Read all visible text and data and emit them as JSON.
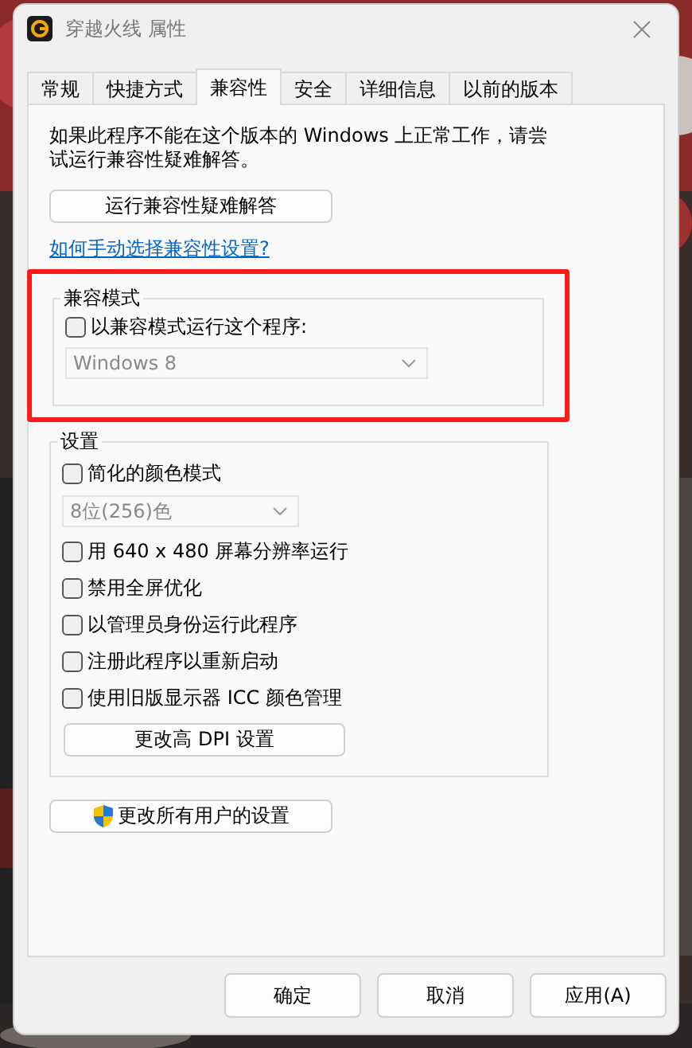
{
  "window": {
    "title": "穿越火线 属性"
  },
  "tabs": [
    {
      "label": "常规",
      "selected": false
    },
    {
      "label": "快捷方式",
      "selected": false
    },
    {
      "label": "兼容性",
      "selected": true
    },
    {
      "label": "安全",
      "selected": false
    },
    {
      "label": "详细信息",
      "selected": false
    },
    {
      "label": "以前的版本",
      "selected": false
    }
  ],
  "description": "如果此程序不能在这个版本的 Windows 上正常工作，请尝试运行兼容性疑难解答。",
  "troubleshoot_button": "运行兼容性疑难解答",
  "help_link": "如何手动选择兼容性设置?",
  "compat_group": {
    "title": "兼容模式",
    "highlighted": true,
    "checkbox": {
      "label": "以兼容模式运行这个程序:",
      "checked": false
    },
    "os_select": {
      "value": "Windows 8",
      "disabled": true
    }
  },
  "settings_group": {
    "title": "设置",
    "items": [
      {
        "kind": "checkbox",
        "label": "简化的颜色模式",
        "checked": false
      },
      {
        "kind": "select",
        "value": "8位(256)色",
        "disabled": true
      },
      {
        "kind": "checkbox",
        "label": "用 640 x 480 屏幕分辨率运行",
        "checked": false
      },
      {
        "kind": "checkbox",
        "label": "禁用全屏优化",
        "checked": false
      },
      {
        "kind": "checkbox",
        "label": "以管理员身份运行此程序",
        "checked": false
      },
      {
        "kind": "checkbox",
        "label": "注册此程序以重新启动",
        "checked": false
      },
      {
        "kind": "checkbox",
        "label": "使用旧版显示器 ICC 颜色管理",
        "checked": false
      },
      {
        "kind": "button",
        "label": "更改高 DPI 设置"
      }
    ]
  },
  "all_users_button": "更改所有用户的设置",
  "buttons": [
    "确定",
    "取消",
    "应用(A)"
  ]
}
